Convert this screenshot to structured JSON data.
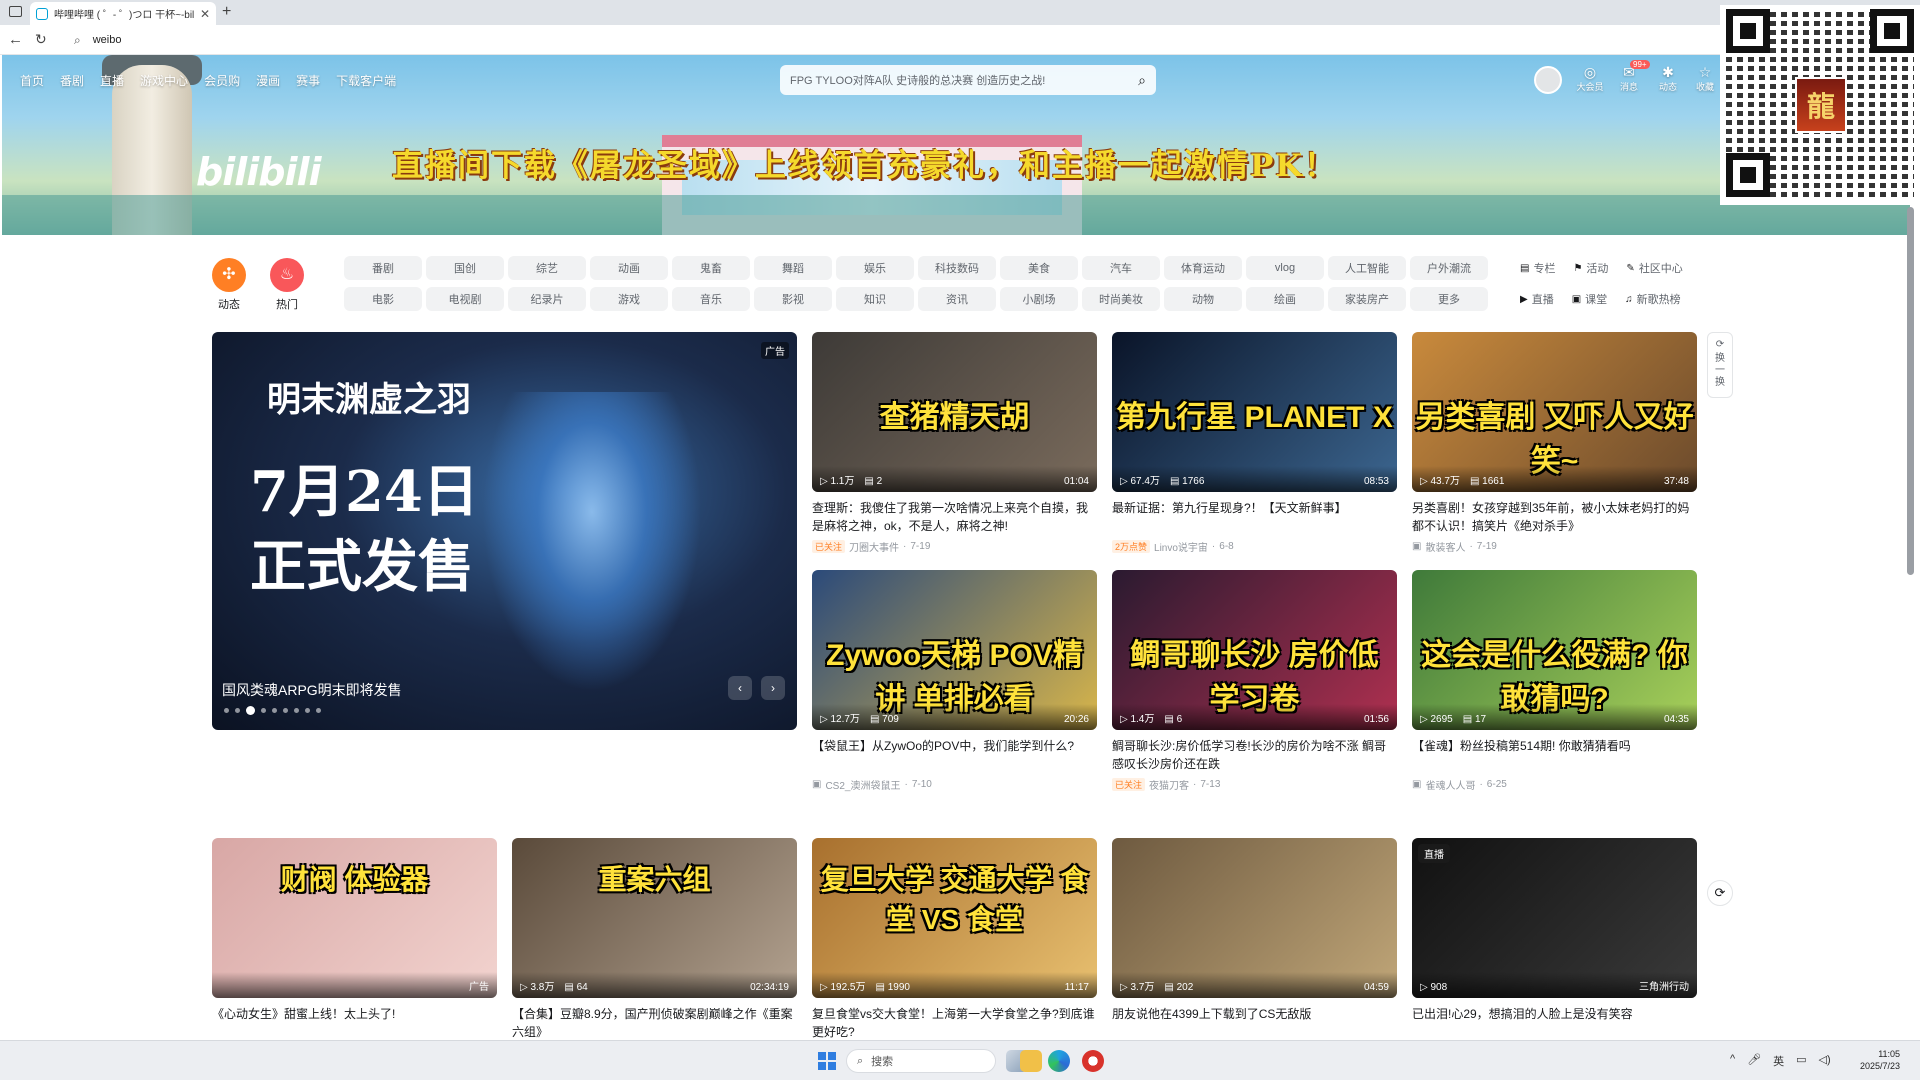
{
  "browser": {
    "tab_title": "哔哩哔哩 ( ゜- ゜)つロ 干杯~-bilibili",
    "url": "weibo"
  },
  "banner": {
    "logo": "bilibili",
    "ad_text": "直播间下载《屠龙圣域》上线领首充豪礼，和主播一起激情PK！"
  },
  "topnav": {
    "items": [
      "首页",
      "番剧",
      "直播",
      "游戏中心",
      "会员购",
      "漫画",
      "赛事",
      "下载客户端"
    ]
  },
  "search": {
    "placeholder": "FPG TYLOO对阵A队 史诗般的总决赛 创造历史之战!"
  },
  "right_nav": {
    "items": [
      {
        "label": "大会员",
        "icon": "vip-icon"
      },
      {
        "label": "消息",
        "icon": "message-icon"
      },
      {
        "label": "动态",
        "icon": "dynamic-icon"
      },
      {
        "label": "收藏",
        "icon": "favorite-icon"
      }
    ],
    "badge": "99+"
  },
  "channels": {
    "big": [
      {
        "label": "动态",
        "color": "#ff7f24"
      },
      {
        "label": "热门",
        "color": "#f9575a"
      }
    ],
    "row1": [
      "番剧",
      "国创",
      "综艺",
      "动画",
      "鬼畜",
      "舞蹈",
      "娱乐",
      "科技数码",
      "美食",
      "汽车",
      "体育运动",
      "vlog",
      "人工智能",
      "户外潮流"
    ],
    "row2": [
      "电影",
      "电视剧",
      "纪录片",
      "游戏",
      "音乐",
      "影视",
      "知识",
      "资讯",
      "小剧场",
      "时尚美妆",
      "动物",
      "绘画",
      "家装房产",
      "更多"
    ],
    "side_row1": [
      "专栏",
      "活动",
      "社区中心"
    ],
    "side_row2": [
      "直播",
      "课堂",
      "新歌热榜"
    ]
  },
  "carousel": {
    "promo_line1": "明末渊虚之羽",
    "promo_line2": "7月24日",
    "promo_line3": "正式发售",
    "ad_tag": "广告",
    "caption": "国风类魂ARPG明末即将发售",
    "dot_count": 9,
    "active_dot": 2
  },
  "refresh": {
    "label": "换一换"
  },
  "videos": [
    {
      "thumb_text": "查猪精天胡",
      "views": "1.1万",
      "comments": "2",
      "duration": "01:04",
      "title": "查理斯：我傻住了我第一次啥情况上来亮个自摸，我是麻将之神，ok，不是人，麻将之神!",
      "tag": "已关注",
      "author": "刀圈大事件",
      "date": "7-19",
      "colors": [
        "#3d3a37",
        "#7a6b5c"
      ]
    },
    {
      "thumb_text": "第九行星 PLANET X",
      "views": "67.4万",
      "comments": "1766",
      "duration": "08:53",
      "title": "最新证据：第九行星现身?！【天文新鲜事】",
      "tag": "2万点赞",
      "author": "Linvo说宇宙",
      "date": "6-8",
      "colors": [
        "#0a1428",
        "#3c6690"
      ]
    },
    {
      "thumb_text": "另类喜剧 又吓人又好笑~",
      "views": "43.7万",
      "comments": "1661",
      "duration": "37:48",
      "title": "另类喜剧！女孩穿越到35年前，被小太妹老妈打的妈都不认识！搞笑片《绝对杀手》",
      "tag": "",
      "author": "散装客人",
      "date": "7-19",
      "colors": [
        "#c98a3c",
        "#6b4a2c"
      ]
    },
    {
      "thumb_text": "Zywoo天梯 POV精讲 单排必看",
      "views": "12.7万",
      "comments": "709",
      "duration": "20:26",
      "title": "【袋鼠王】从ZywOo的POV中，我们能学到什么?",
      "tag": "",
      "author": "CS2_澳洲袋鼠王",
      "date": "7-10",
      "colors": [
        "#2b4a7a",
        "#d9b64a"
      ]
    },
    {
      "thumb_text": "鲷哥聊长沙 房价低 学习卷",
      "views": "1.4万",
      "comments": "6",
      "duration": "01:56",
      "title": "鲷哥聊长沙:房价低学习卷!长沙的房价为啥不涨 鲷哥感叹长沙房价还在跌",
      "tag": "已关注",
      "author": "夜猫刀客",
      "date": "7-13",
      "colors": [
        "#2a1a30",
        "#b03050"
      ]
    },
    {
      "thumb_text": "这会是什么役满? 你敢猜吗?",
      "views": "2695",
      "comments": "17",
      "duration": "04:35",
      "title": "【雀魂】粉丝投稿第514期! 你敢猜猜看吗",
      "tag": "",
      "author": "雀魂人人哥",
      "date": "6-25",
      "colors": [
        "#3f7a3a",
        "#a8d05a"
      ]
    },
    {
      "thumb_text": "财阀 体验器",
      "views": "",
      "comments": "",
      "duration": "广告",
      "title": "《心动女生》甜蜜上线！太上头了!",
      "tag": "",
      "author": "",
      "date": "",
      "colors": [
        "#d8a7a5",
        "#f2d3cf"
      ]
    },
    {
      "thumb_text": "重案六组",
      "views": "3.8万",
      "comments": "64",
      "duration": "02:34:19",
      "title": "【合集】豆瓣8.9分，国产刑侦破案剧巅峰之作《重案六组》",
      "tag": "",
      "author": "",
      "date": "",
      "colors": [
        "#5a4a3a",
        "#b3a290"
      ]
    },
    {
      "thumb_text": "复旦大学 交通大学 食堂 VS 食堂",
      "views": "192.5万",
      "comments": "1990",
      "duration": "11:17",
      "title": "复旦食堂vs交大食堂！上海第一大学食堂之争?到底谁更好吃?",
      "tag": "",
      "author": "",
      "date": "",
      "colors": [
        "#a8702e",
        "#e8c070"
      ]
    },
    {
      "thumb_text": "",
      "views": "3.7万",
      "comments": "202",
      "duration": "04:59",
      "title": "朋友说他在4399上下载到了CS无敌版",
      "tag": "",
      "author": "",
      "date": "",
      "colors": [
        "#6e5a40",
        "#c0a678"
      ]
    },
    {
      "thumb_text": "",
      "views": "908",
      "comments": "",
      "duration": "三角洲行动",
      "title": "已出泪!心29，想搞泪的人脸上是没有笑容",
      "tag": "直播中",
      "author": "",
      "date": "",
      "live": "直播",
      "colors": [
        "#111",
        "#3a3a3a"
      ]
    }
  ],
  "taskbar": {
    "search_placeholder": "搜索",
    "tray": [
      "^",
      "英"
    ],
    "time": "11:05",
    "date": "2025/7/23"
  }
}
